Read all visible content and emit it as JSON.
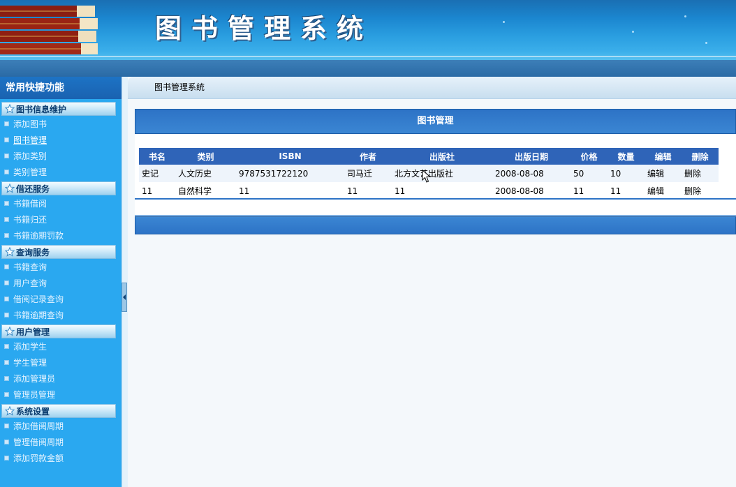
{
  "header": {
    "title": "图书管理系统"
  },
  "sidebar": {
    "title": "常用快捷功能",
    "groups": [
      {
        "label": "图书信息维护",
        "items": [
          "添加图书",
          "图书管理",
          "添加类别",
          "类别管理"
        ]
      },
      {
        "label": "借还服务",
        "items": [
          "书籍借阅",
          "书籍归还",
          "书籍逾期罚款"
        ]
      },
      {
        "label": "查询服务",
        "items": [
          "书籍查询",
          "用户查询",
          "借阅记录查询",
          "书籍逾期查询"
        ]
      },
      {
        "label": "用户管理",
        "items": [
          "添加学生",
          "学生管理",
          "添加管理员",
          "管理员管理"
        ]
      },
      {
        "label": "系统设置",
        "items": [
          "添加借阅周期",
          "管理借阅周期",
          "添加罚款金额"
        ]
      }
    ]
  },
  "breadcrumb": "图书管理系统",
  "panel": {
    "title": "图书管理",
    "columns": [
      "书名",
      "类别",
      "ISBN",
      "作者",
      "出版社",
      "出版日期",
      "价格",
      "数量",
      "编辑",
      "删除"
    ],
    "rows": [
      [
        "史记",
        "人文历史",
        "9787531722120",
        "司马迁",
        "北方文艺出版社",
        "2008-08-08",
        "50",
        "10",
        "编辑",
        "删除"
      ],
      [
        "11",
        "自然科学",
        "11",
        "11",
        "11",
        "2008-08-08",
        "11",
        "11",
        "编辑",
        "删除"
      ]
    ]
  },
  "colors": {
    "header": "#1b86cf",
    "sidebar": "#2aa8f0",
    "table_head": "#2f64b8",
    "panel_head": "#2d73c6"
  }
}
